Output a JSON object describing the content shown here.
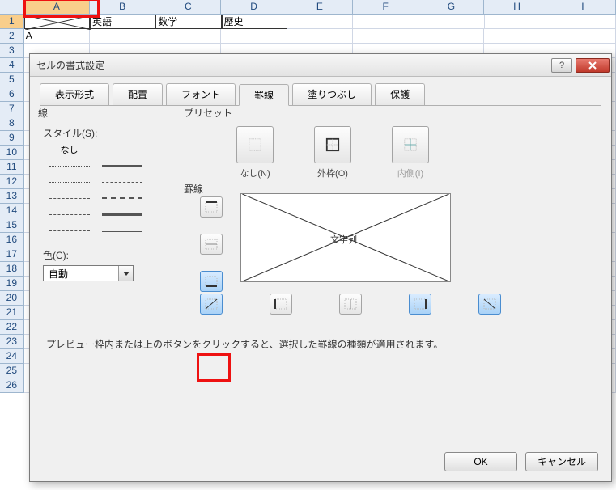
{
  "sheet": {
    "columns": [
      "A",
      "B",
      "C",
      "D",
      "E",
      "F",
      "G",
      "H",
      "I"
    ],
    "rows": [
      1,
      2,
      3,
      4,
      5,
      6,
      7,
      8,
      9,
      10,
      11,
      12,
      13,
      14,
      15,
      16,
      17,
      18,
      19,
      20,
      21,
      22,
      23,
      24,
      25,
      26
    ],
    "row1": {
      "b": "英語",
      "c": "数学",
      "d": "歴史"
    },
    "row2": {
      "a": "A"
    }
  },
  "dialog": {
    "title": "セルの書式設定",
    "tabs": {
      "number": "表示形式",
      "align": "配置",
      "font": "フォント",
      "border": "罫線",
      "fill": "塗りつぶし",
      "protect": "保護"
    },
    "line": {
      "group": "線",
      "style_label": "スタイル(S):",
      "none": "なし",
      "color_label": "色(C):",
      "color_auto": "自動"
    },
    "preset": {
      "group": "プリセット",
      "none": "なし(N)",
      "outline": "外枠(O)",
      "inside": "内側(I)"
    },
    "border": {
      "group": "罫線",
      "preview_label": "文字列"
    },
    "hint": "プレビュー枠内または上のボタンをクリックすると、選択した罫線の種類が適用されます。",
    "ok": "OK",
    "cancel": "キャンセル"
  }
}
